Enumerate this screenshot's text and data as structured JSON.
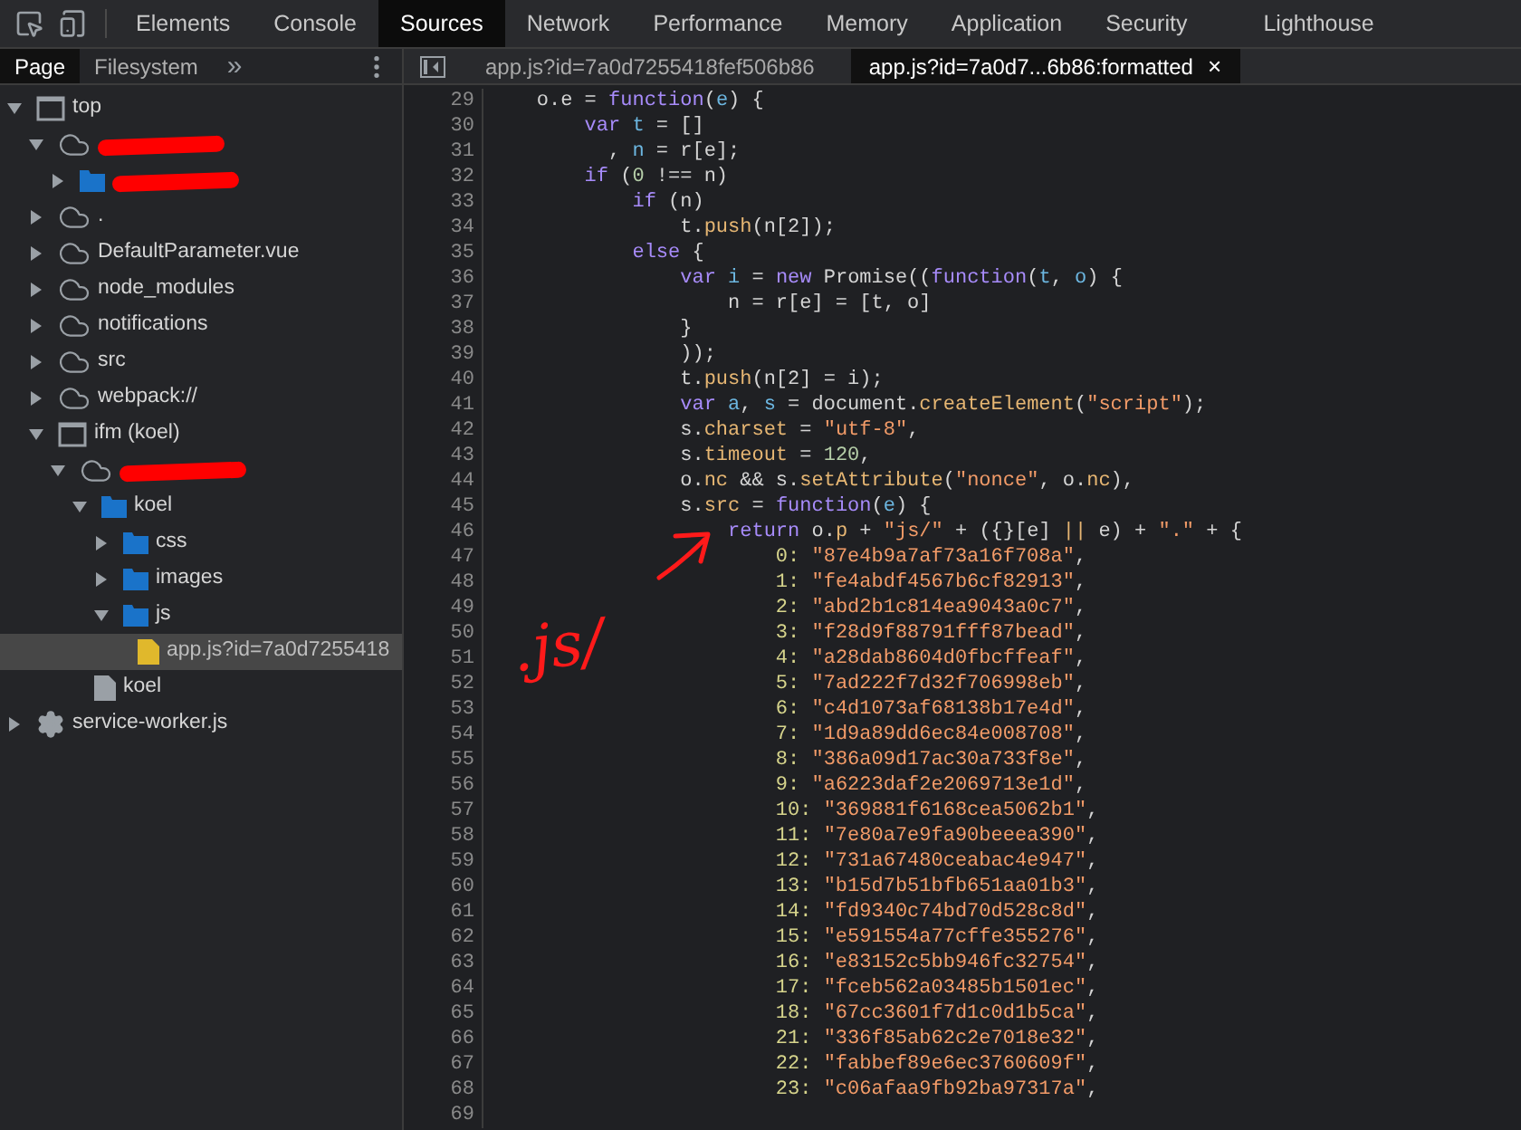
{
  "toolbar": {
    "tabs": [
      {
        "label": "Elements",
        "selected": false
      },
      {
        "label": "Console",
        "selected": false
      },
      {
        "label": "Sources",
        "selected": true
      },
      {
        "label": "Network",
        "selected": false
      },
      {
        "label": "Performance",
        "selected": false
      },
      {
        "label": "Memory",
        "selected": false
      },
      {
        "label": "Application",
        "selected": false
      },
      {
        "label": "Security",
        "selected": false
      },
      {
        "label": "Lighthouse",
        "selected": false
      }
    ]
  },
  "navigator": {
    "tabs": [
      {
        "label": "Page",
        "selected": true
      },
      {
        "label": "Filesystem",
        "selected": false
      }
    ],
    "more": "»",
    "tree": [
      {
        "label": "top",
        "kind": "frame",
        "expanded": true,
        "redacted": false,
        "selected": false,
        "children": [
          {
            "kind": "cloud",
            "expanded": true,
            "redacted": true,
            "selected": false,
            "children": [
              {
                "kind": "folder",
                "expanded": false,
                "redacted": true,
                "selected": false
              }
            ]
          },
          {
            "label": ".",
            "kind": "cloud",
            "expanded": false,
            "redacted": false,
            "selected": false
          },
          {
            "label": "DefaultParameter.vue",
            "kind": "cloud",
            "expanded": false,
            "redacted": false,
            "selected": false
          },
          {
            "label": "node_modules",
            "kind": "cloud",
            "expanded": false,
            "redacted": false,
            "selected": false
          },
          {
            "label": "notifications",
            "kind": "cloud",
            "expanded": false,
            "redacted": false,
            "selected": false
          },
          {
            "label": "src",
            "kind": "cloud",
            "expanded": false,
            "redacted": false,
            "selected": false
          },
          {
            "label": "webpack://",
            "kind": "cloud",
            "expanded": false,
            "redacted": false,
            "selected": false
          },
          {
            "label": "ifm (koel)",
            "kind": "frame",
            "expanded": true,
            "redacted": false,
            "selected": false,
            "children": [
              {
                "kind": "cloud",
                "expanded": true,
                "redacted": true,
                "selected": false,
                "children": [
                  {
                    "label": "koel",
                    "kind": "folder",
                    "expanded": true,
                    "redacted": false,
                    "selected": false,
                    "children": [
                      {
                        "label": "css",
                        "kind": "folder",
                        "expanded": false,
                        "redacted": false,
                        "selected": false
                      },
                      {
                        "label": "images",
                        "kind": "folder",
                        "expanded": false,
                        "redacted": false,
                        "selected": false
                      },
                      {
                        "label": "js",
                        "kind": "folder",
                        "expanded": true,
                        "redacted": false,
                        "selected": false,
                        "children": [
                          {
                            "label": "app.js?id=7a0d7255418",
                            "kind": "script",
                            "redacted": false,
                            "selected": true
                          }
                        ]
                      }
                    ]
                  },
                  {
                    "label": "koel",
                    "kind": "document",
                    "redacted": false,
                    "selected": false
                  }
                ]
              }
            ]
          }
        ]
      },
      {
        "label": "service-worker.js",
        "kind": "gear",
        "expanded": false,
        "redacted": false,
        "selected": false
      }
    ]
  },
  "editor": {
    "tabs": [
      {
        "label": "app.js?id=7a0d7255418fef506b86",
        "selected": false,
        "closable": false
      },
      {
        "label": "app.js?id=7a0d7...6b86:formatted",
        "selected": true,
        "closable": true
      }
    ],
    "close": "×",
    "lines": [
      {
        "n": "29",
        "tokens": [
          {
            "kind": "t",
            "text": "    o.e = "
          },
          {
            "kind": "k",
            "text": "function"
          },
          {
            "kind": "t",
            "text": "("
          },
          {
            "kind": "v",
            "text": "e"
          },
          {
            "kind": "t",
            "text": ") {"
          }
        ]
      },
      {
        "n": "30",
        "tokens": [
          {
            "kind": "k",
            "text": "        var "
          },
          {
            "kind": "v",
            "text": "t"
          },
          {
            "kind": "t",
            "text": " = []"
          }
        ]
      },
      {
        "n": "31",
        "tokens": [
          {
            "kind": "t",
            "text": "          , "
          },
          {
            "kind": "v",
            "text": "n"
          },
          {
            "kind": "t",
            "text": " = r[e];"
          }
        ]
      },
      {
        "n": "32",
        "tokens": [
          {
            "kind": "k",
            "text": "        if"
          },
          {
            "kind": "t",
            "text": " ("
          },
          {
            "kind": "n",
            "text": "0"
          },
          {
            "kind": "t",
            "text": " !== n)"
          }
        ]
      },
      {
        "n": "33",
        "tokens": [
          {
            "kind": "k",
            "text": "            if"
          },
          {
            "kind": "t",
            "text": " (n)"
          }
        ]
      },
      {
        "n": "34",
        "tokens": [
          {
            "kind": "t",
            "text": "                t."
          },
          {
            "kind": "p",
            "text": "push"
          },
          {
            "kind": "t",
            "text": "(n[2]);"
          }
        ]
      },
      {
        "n": "35",
        "tokens": [
          {
            "kind": "k",
            "text": "            else"
          },
          {
            "kind": "t",
            "text": " {"
          }
        ]
      },
      {
        "n": "36",
        "tokens": [
          {
            "kind": "k",
            "text": "                var "
          },
          {
            "kind": "v",
            "text": "i"
          },
          {
            "kind": "t",
            "text": " = "
          },
          {
            "kind": "k",
            "text": "new"
          },
          {
            "kind": "t",
            "text": " Promise(("
          },
          {
            "kind": "k",
            "text": "function"
          },
          {
            "kind": "t",
            "text": "("
          },
          {
            "kind": "v",
            "text": "t"
          },
          {
            "kind": "t",
            "text": ", "
          },
          {
            "kind": "v",
            "text": "o"
          },
          {
            "kind": "t",
            "text": ") {"
          }
        ]
      },
      {
        "n": "37",
        "tokens": [
          {
            "kind": "t",
            "text": "                    n = r[e] = [t, o]"
          }
        ]
      },
      {
        "n": "38",
        "tokens": [
          {
            "kind": "t",
            "text": "                }"
          }
        ]
      },
      {
        "n": "39",
        "tokens": [
          {
            "kind": "t",
            "text": "                ));"
          }
        ]
      },
      {
        "n": "40",
        "tokens": [
          {
            "kind": "t",
            "text": "                t."
          },
          {
            "kind": "p",
            "text": "push"
          },
          {
            "kind": "t",
            "text": "(n[2] = i);"
          }
        ]
      },
      {
        "n": "41",
        "tokens": [
          {
            "kind": "k",
            "text": "                var "
          },
          {
            "kind": "v",
            "text": "a"
          },
          {
            "kind": "t",
            "text": ", "
          },
          {
            "kind": "v",
            "text": "s"
          },
          {
            "kind": "t",
            "text": " = document."
          },
          {
            "kind": "p",
            "text": "createElement"
          },
          {
            "kind": "t",
            "text": "("
          },
          {
            "kind": "s",
            "text": "\"script\""
          },
          {
            "kind": "t",
            "text": ");"
          }
        ]
      },
      {
        "n": "42",
        "tokens": [
          {
            "kind": "t",
            "text": "                s."
          },
          {
            "kind": "p",
            "text": "charset"
          },
          {
            "kind": "t",
            "text": " = "
          },
          {
            "kind": "s",
            "text": "\"utf-8\""
          },
          {
            "kind": "t",
            "text": ","
          }
        ]
      },
      {
        "n": "43",
        "tokens": [
          {
            "kind": "t",
            "text": "                s."
          },
          {
            "kind": "p",
            "text": "timeout"
          },
          {
            "kind": "t",
            "text": " = "
          },
          {
            "kind": "n",
            "text": "120"
          },
          {
            "kind": "t",
            "text": ","
          }
        ]
      },
      {
        "n": "44",
        "tokens": [
          {
            "kind": "t",
            "text": "                o."
          },
          {
            "kind": "p",
            "text": "nc"
          },
          {
            "kind": "t",
            "text": " && s."
          },
          {
            "kind": "p",
            "text": "setAttribute"
          },
          {
            "kind": "t",
            "text": "("
          },
          {
            "kind": "s",
            "text": "\"nonce\""
          },
          {
            "kind": "t",
            "text": ", o."
          },
          {
            "kind": "p",
            "text": "nc"
          },
          {
            "kind": "t",
            "text": "),"
          }
        ]
      },
      {
        "n": "45",
        "tokens": [
          {
            "kind": "t",
            "text": "                s."
          },
          {
            "kind": "p",
            "text": "src"
          },
          {
            "kind": "t",
            "text": " = "
          },
          {
            "kind": "k",
            "text": "function"
          },
          {
            "kind": "t",
            "text": "("
          },
          {
            "kind": "v",
            "text": "e"
          },
          {
            "kind": "t",
            "text": ") {"
          }
        ]
      },
      {
        "n": "46",
        "tokens": [
          {
            "kind": "k",
            "text": "                    return"
          },
          {
            "kind": "t",
            "text": " o."
          },
          {
            "kind": "p",
            "text": "p"
          },
          {
            "kind": "t",
            "text": " + "
          },
          {
            "kind": "s",
            "text": "\"js/\""
          },
          {
            "kind": "t",
            "text": " + ({}[e] "
          },
          {
            "kind": "p",
            "text": "||"
          },
          {
            "kind": "t",
            "text": " e) + "
          },
          {
            "kind": "s",
            "text": "\".\""
          },
          {
            "kind": "t",
            "text": " + {"
          }
        ]
      },
      {
        "n": "47",
        "tokens": [
          {
            "kind": "y",
            "text": "                        0:"
          },
          {
            "kind": "s",
            "text": " \"87e4b9a7af73a16f708a\""
          },
          {
            "kind": "t",
            "text": ","
          }
        ]
      },
      {
        "n": "48",
        "tokens": [
          {
            "kind": "y",
            "text": "                        1:"
          },
          {
            "kind": "s",
            "text": " \"fe4abdf4567b6cf82913\""
          },
          {
            "kind": "t",
            "text": ","
          }
        ]
      },
      {
        "n": "49",
        "tokens": [
          {
            "kind": "y",
            "text": "                        2:"
          },
          {
            "kind": "s",
            "text": " \"abd2b1c814ea9043a0c7\""
          },
          {
            "kind": "t",
            "text": ","
          }
        ]
      },
      {
        "n": "50",
        "tokens": [
          {
            "kind": "y",
            "text": "                        3:"
          },
          {
            "kind": "s",
            "text": " \"f28d9f88791fff87bead\""
          },
          {
            "kind": "t",
            "text": ","
          }
        ]
      },
      {
        "n": "51",
        "tokens": [
          {
            "kind": "y",
            "text": "                        4:"
          },
          {
            "kind": "s",
            "text": " \"a28dab8604d0fbcffeaf\""
          },
          {
            "kind": "t",
            "text": ","
          }
        ]
      },
      {
        "n": "52",
        "tokens": [
          {
            "kind": "y",
            "text": "                        5:"
          },
          {
            "kind": "s",
            "text": " \"7ad222f7d32f706998eb\""
          },
          {
            "kind": "t",
            "text": ","
          }
        ]
      },
      {
        "n": "53",
        "tokens": [
          {
            "kind": "y",
            "text": "                        6:"
          },
          {
            "kind": "s",
            "text": " \"c4d1073af68138b17e4d\""
          },
          {
            "kind": "t",
            "text": ","
          }
        ]
      },
      {
        "n": "54",
        "tokens": [
          {
            "kind": "y",
            "text": "                        7:"
          },
          {
            "kind": "s",
            "text": " \"1d9a89dd6ec84e008708\""
          },
          {
            "kind": "t",
            "text": ","
          }
        ]
      },
      {
        "n": "55",
        "tokens": [
          {
            "kind": "y",
            "text": "                        8:"
          },
          {
            "kind": "s",
            "text": " \"386a09d17ac30a733f8e\""
          },
          {
            "kind": "t",
            "text": ","
          }
        ]
      },
      {
        "n": "56",
        "tokens": [
          {
            "kind": "y",
            "text": "                        9:"
          },
          {
            "kind": "s",
            "text": " \"a6223daf2e2069713e1d\""
          },
          {
            "kind": "t",
            "text": ","
          }
        ]
      },
      {
        "n": "57",
        "tokens": [
          {
            "kind": "y",
            "text": "                        10:"
          },
          {
            "kind": "s",
            "text": " \"369881f6168cea5062b1\""
          },
          {
            "kind": "t",
            "text": ","
          }
        ]
      },
      {
        "n": "58",
        "tokens": [
          {
            "kind": "y",
            "text": "                        11:"
          },
          {
            "kind": "s",
            "text": " \"7e80a7e9fa90beeea390\""
          },
          {
            "kind": "t",
            "text": ","
          }
        ]
      },
      {
        "n": "59",
        "tokens": [
          {
            "kind": "y",
            "text": "                        12:"
          },
          {
            "kind": "s",
            "text": " \"731a67480ceabac4e947\""
          },
          {
            "kind": "t",
            "text": ","
          }
        ]
      },
      {
        "n": "60",
        "tokens": [
          {
            "kind": "y",
            "text": "                        13:"
          },
          {
            "kind": "s",
            "text": " \"b15d7b51bfb651aa01b3\""
          },
          {
            "kind": "t",
            "text": ","
          }
        ]
      },
      {
        "n": "61",
        "tokens": [
          {
            "kind": "y",
            "text": "                        14:"
          },
          {
            "kind": "s",
            "text": " \"fd9340c74bd70d528c8d\""
          },
          {
            "kind": "t",
            "text": ","
          }
        ]
      },
      {
        "n": "62",
        "tokens": [
          {
            "kind": "y",
            "text": "                        15:"
          },
          {
            "kind": "s",
            "text": " \"e591554a77cffe355276\""
          },
          {
            "kind": "t",
            "text": ","
          }
        ]
      },
      {
        "n": "63",
        "tokens": [
          {
            "kind": "y",
            "text": "                        16:"
          },
          {
            "kind": "s",
            "text": " \"e83152c5bb946fc32754\""
          },
          {
            "kind": "t",
            "text": ","
          }
        ]
      },
      {
        "n": "64",
        "tokens": [
          {
            "kind": "y",
            "text": "                        17:"
          },
          {
            "kind": "s",
            "text": " \"fceb562a03485b1501ec\""
          },
          {
            "kind": "t",
            "text": ","
          }
        ]
      },
      {
        "n": "65",
        "tokens": [
          {
            "kind": "y",
            "text": "                        18:"
          },
          {
            "kind": "s",
            "text": " \"67cc3601f7d1c0d1b5ca\""
          },
          {
            "kind": "t",
            "text": ","
          }
        ]
      },
      {
        "n": "66",
        "tokens": [
          {
            "kind": "y",
            "text": "                        21:"
          },
          {
            "kind": "s",
            "text": " \"336f85ab62c2e7018e32\""
          },
          {
            "kind": "t",
            "text": ","
          }
        ]
      },
      {
        "n": "67",
        "tokens": [
          {
            "kind": "y",
            "text": "                        22:"
          },
          {
            "kind": "s",
            "text": " \"fabbef89e6ec3760609f\""
          },
          {
            "kind": "t",
            "text": ","
          }
        ]
      },
      {
        "n": "68",
        "tokens": [
          {
            "kind": "y",
            "text": "                        23:"
          },
          {
            "kind": "s",
            "text": " \"c06afaa9fb92ba97317a\""
          },
          {
            "kind": "t",
            "text": ","
          }
        ]
      },
      {
        "n": "69"
      }
    ],
    "annotation": {
      "text": ".js/"
    }
  }
}
